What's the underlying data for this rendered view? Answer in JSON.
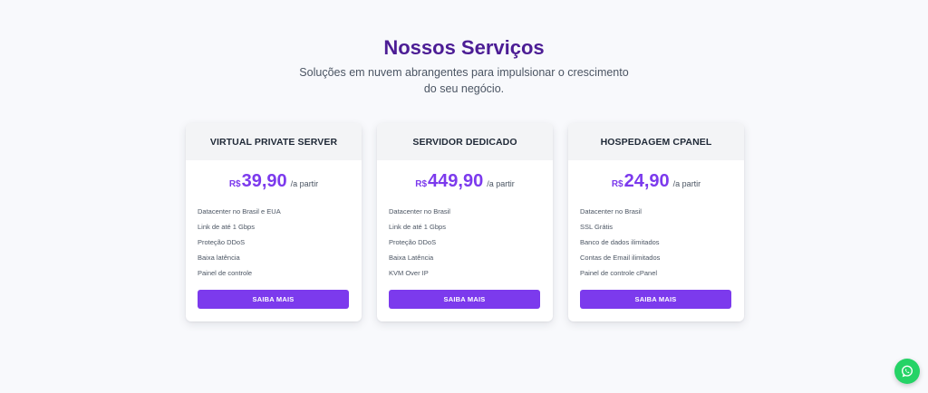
{
  "section": {
    "title": "Nossos Serviços",
    "subtitle": "Soluções em nuvem abrangentes para impulsionar o crescimento do seu negócio."
  },
  "plans": [
    {
      "name": "VIRTUAL PRIVATE SERVER",
      "currency": "R$",
      "price": "39,90",
      "per": "/a partir",
      "features": [
        "Datacenter no Brasil e EUA",
        "Link de até 1 Gbps",
        "Proteção DDoS",
        "Baixa latência",
        "Painel de controle"
      ],
      "cta": "SAIBA MAIS"
    },
    {
      "name": "SERVIDOR DEDICADO",
      "currency": "R$",
      "price": "449,90",
      "per": "/a partir",
      "features": [
        "Datacenter no Brasil",
        "Link de até 1 Gbps",
        "Proteção DDoS",
        "Baixa Latência",
        "KVM Over IP"
      ],
      "cta": "SAIBA MAIS"
    },
    {
      "name": "HOSPEDAGEM CPANEL",
      "currency": "R$",
      "price": "24,90",
      "per": "/a partir",
      "features": [
        "Datacenter no Brasil",
        "SSL Grátis",
        "Banco de dados ilimitados",
        "Contas de Email ilimitados",
        "Painel de controle cPanel"
      ],
      "cta": "SAIBA MAIS"
    }
  ],
  "colors": {
    "accent": "#7c3aed",
    "title": "#4c1d95",
    "whatsapp": "#25d366"
  },
  "floating": {
    "icon": "whatsapp-icon"
  }
}
